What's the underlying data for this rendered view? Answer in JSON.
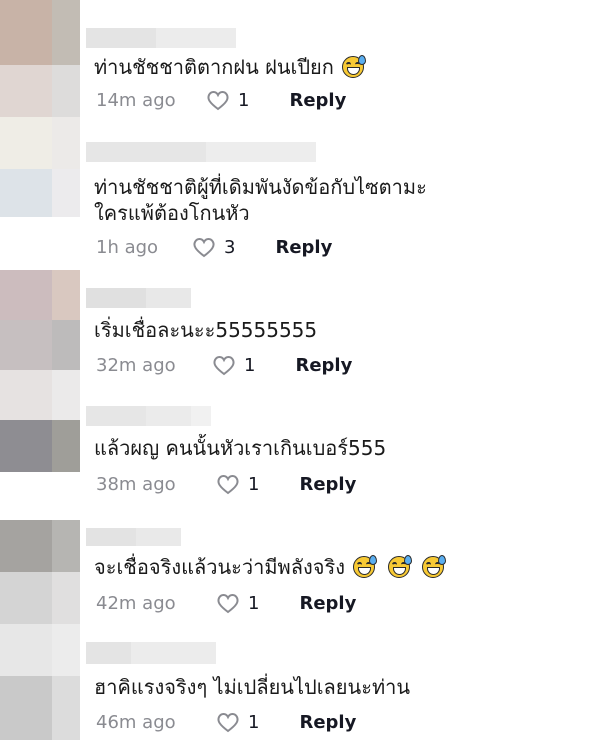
{
  "comments": [
    {
      "text": "ท่านชัชชาติตากฝน ฝนเปียก",
      "emoji_count": 1,
      "emoji": "sweat-smile-emoji",
      "time": "14m ago",
      "likes": "1",
      "reply_label": "Reply"
    },
    {
      "text_line1": "ท่านชัชชาติผู้ที่เดิมพันงัดข้อกับไซตามะ",
      "text_line2": "ใครแพ้ต้องโกนหัว",
      "time": "1h ago",
      "likes": "3",
      "reply_label": "Reply"
    },
    {
      "text": "เริ่มเชื่อละนะะ55555555",
      "time": "32m ago",
      "likes": "1",
      "reply_label": "Reply"
    },
    {
      "text": "แล้วผญ คนนั้นหัวเราเกินเบอร์555",
      "time": "38m ago",
      "likes": "1",
      "reply_label": "Reply"
    },
    {
      "text": "จะเชื่อจริงแล้วนะว่ามีพลังจริง",
      "emoji_count": 3,
      "emoji": "grinning-sweat-emoji",
      "time": "42m ago",
      "likes": "1",
      "reply_label": "Reply"
    },
    {
      "text": "ฮาคิแรงจริงๆ ไม่เปลี่ยนไปเลยนะท่าน",
      "time": "46m ago",
      "likes": "1",
      "reply_label": "Reply"
    }
  ],
  "icons": {
    "like": "heart-outline-icon"
  },
  "colors": {
    "text": "#161823",
    "meta": "#8a8b91",
    "emoji": "#f7c934"
  }
}
